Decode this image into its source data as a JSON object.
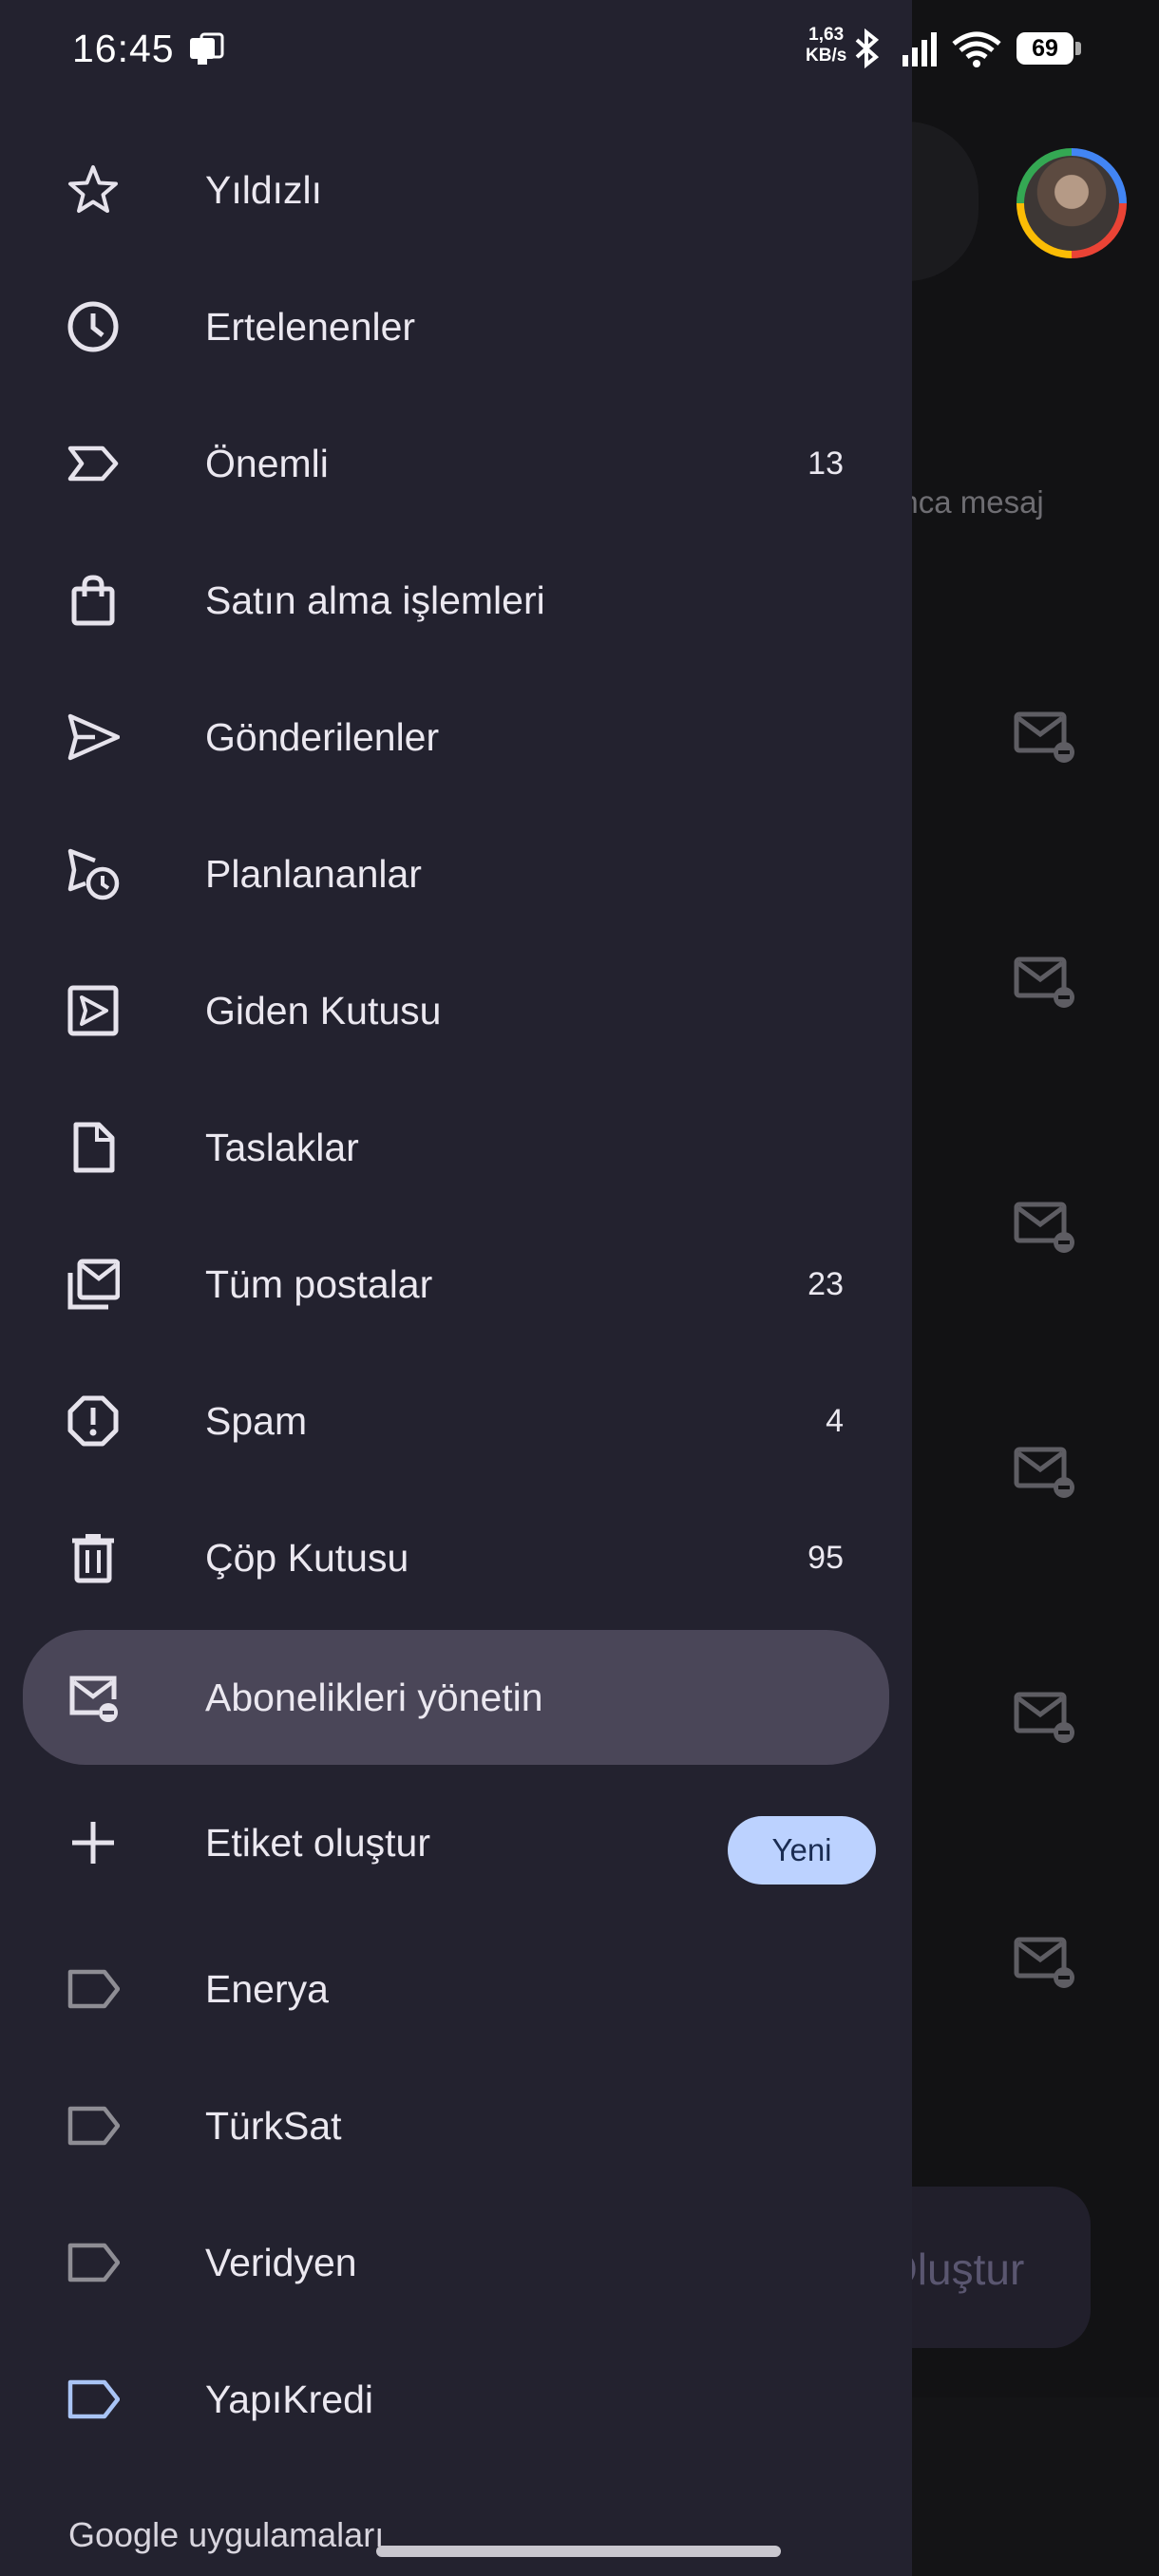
{
  "status_bar": {
    "time": "16:45",
    "speed_value": "1,63",
    "speed_unit": "KB/s",
    "battery": "69"
  },
  "background": {
    "hint_text": "unca mesaj",
    "compose_label": "Oluştur"
  },
  "drawer": {
    "items": [
      {
        "label": "Yıldızlı",
        "count": "",
        "icon": "star-icon"
      },
      {
        "label": "Ertelenenler",
        "count": "",
        "icon": "clock-icon"
      },
      {
        "label": "Önemli",
        "count": "13",
        "icon": "important-icon"
      },
      {
        "label": "Satın alma işlemleri",
        "count": "",
        "icon": "shopping-bag-icon"
      },
      {
        "label": "Gönderilenler",
        "count": "",
        "icon": "send-icon"
      },
      {
        "label": "Planlananlar",
        "count": "",
        "icon": "schedule-send-icon"
      },
      {
        "label": "Giden Kutusu",
        "count": "",
        "icon": "outbox-icon"
      },
      {
        "label": "Taslaklar",
        "count": "",
        "icon": "draft-icon"
      },
      {
        "label": "Tüm postalar",
        "count": "23",
        "icon": "all-mail-icon"
      },
      {
        "label": "Spam",
        "count": "4",
        "icon": "spam-icon"
      },
      {
        "label": "Çöp Kutusu",
        "count": "95",
        "icon": "trash-icon"
      },
      {
        "label": "Abonelikleri yönetin",
        "count": "",
        "icon": "unsubscribe-mail-icon",
        "active": true
      }
    ],
    "create_label": {
      "label": "Etiket oluştur",
      "badge": "Yeni"
    },
    "labels": [
      {
        "label": "Enerya",
        "color": "#8e8d94"
      },
      {
        "label": "TürkSat",
        "color": "#8e8d94"
      },
      {
        "label": "Veridyen",
        "color": "#8e8d94"
      },
      {
        "label": "YapıKredi",
        "color": "#a9c4f5"
      }
    ],
    "section_title": "Google uygulamaları"
  },
  "colors": {
    "drawer_bg": "#23222f",
    "active_bg": "#4a4658",
    "badge_bg": "#bcd2ff"
  }
}
